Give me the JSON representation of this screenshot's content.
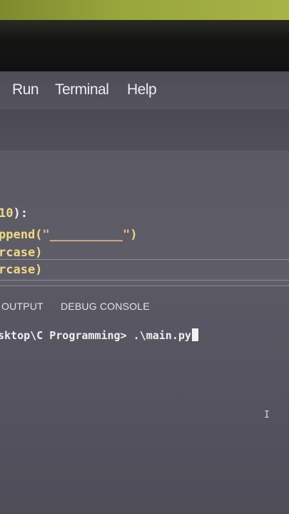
{
  "menu": {
    "run": "Run",
    "terminal": "Terminal",
    "help": "Help"
  },
  "editor": {
    "line1_num": "10",
    "line1_rest": "):",
    "line2_a": "ppend(",
    "line2_str": "\"__________\"",
    "line2_b": ")",
    "line3": "rcase)",
    "line4": "rcase)"
  },
  "panel": {
    "tabs": [
      "OUTPUT",
      "DEBUG CONSOLE"
    ]
  },
  "terminal": {
    "prompt": "sktop\\C Programming> ",
    "command": ".\\main.py"
  },
  "cursor_icon": "text-cursor-icon"
}
